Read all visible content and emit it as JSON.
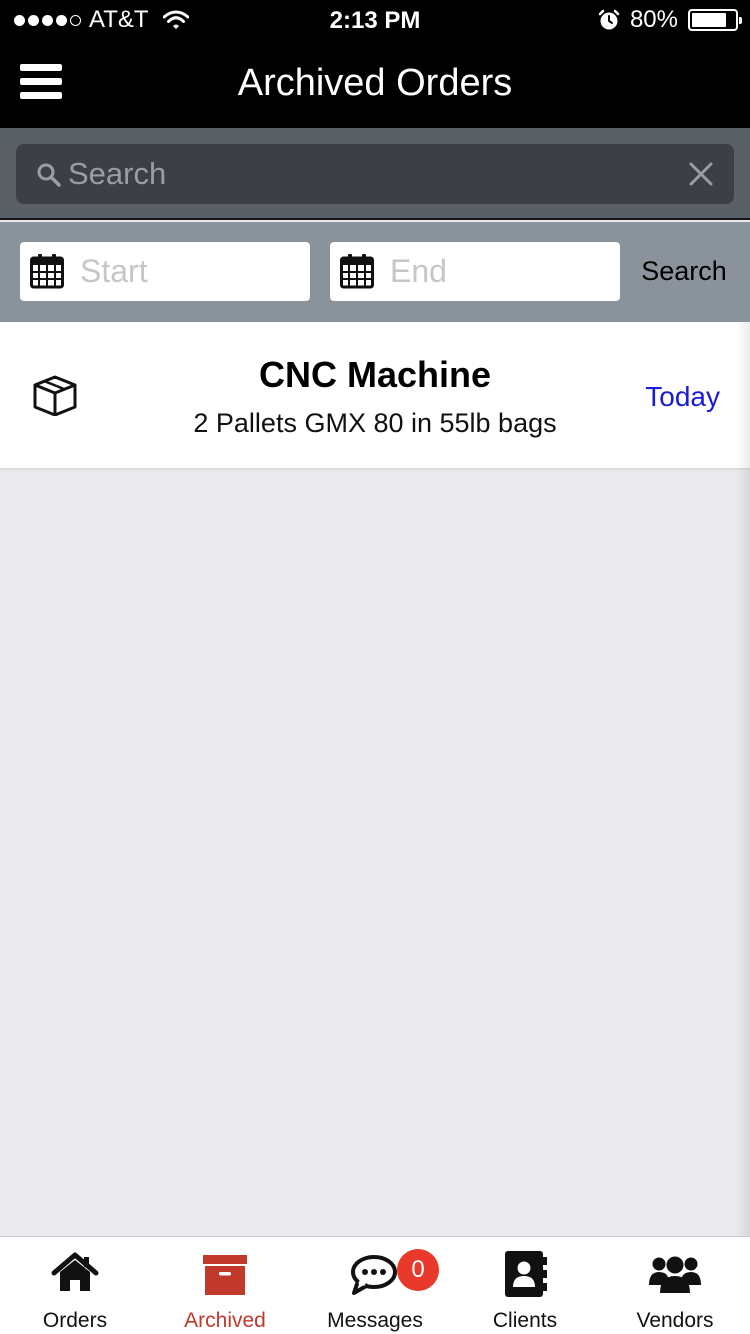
{
  "status_bar": {
    "carrier": "AT&T",
    "time": "2:13 PM",
    "battery_text": "80%",
    "battery_level": 0.8,
    "signal_bars": 4,
    "signal_total": 5
  },
  "nav": {
    "title": "Archived Orders",
    "menu_icon": "hamburger-icon"
  },
  "search": {
    "placeholder": "Search",
    "value": ""
  },
  "date_filter": {
    "start_placeholder": "Start",
    "end_placeholder": "End",
    "search_label": "Search"
  },
  "orders": [
    {
      "title": "CNC Machine",
      "subtitle": "2 Pallets GMX 80 in 55lb bags",
      "date": "Today",
      "icon": "box-icon"
    }
  ],
  "tabs": [
    {
      "label": "Orders",
      "icon": "home-icon",
      "active": false
    },
    {
      "label": "Archived",
      "icon": "archive-icon",
      "active": true
    },
    {
      "label": "Messages",
      "icon": "chat-icon",
      "active": false,
      "badge": "0"
    },
    {
      "label": "Clients",
      "icon": "contacts-icon",
      "active": false
    },
    {
      "label": "Vendors",
      "icon": "users-icon",
      "active": false
    }
  ],
  "colors": {
    "active_tab": "#c0392b",
    "badge": "#e8392b",
    "date_link": "#1a1adb"
  }
}
